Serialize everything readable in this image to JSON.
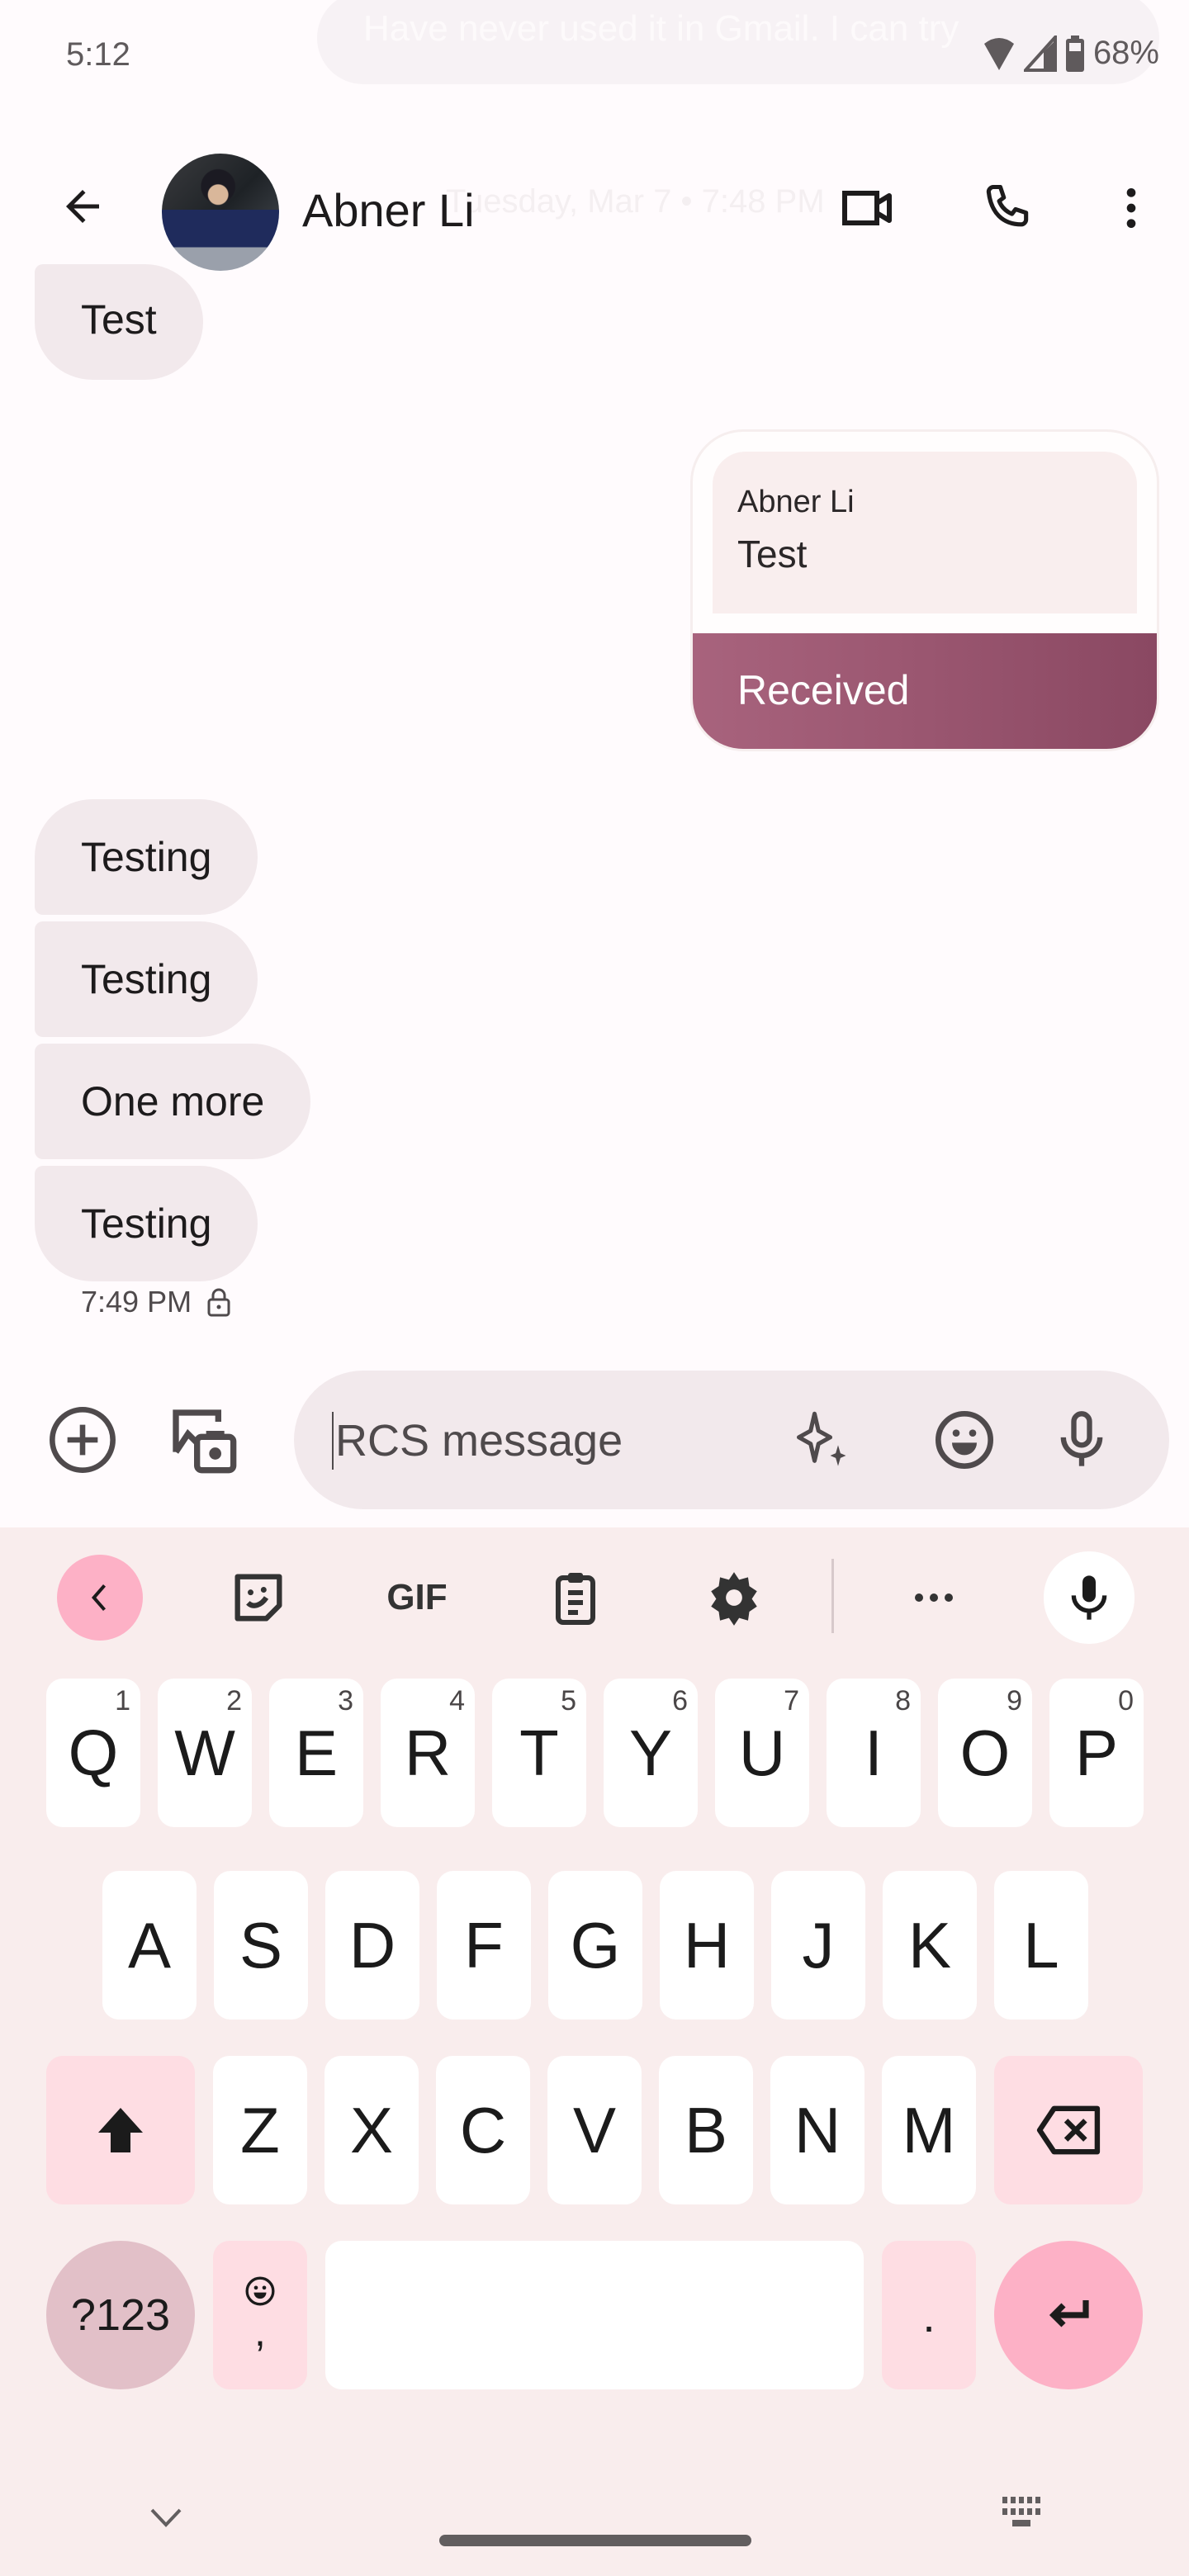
{
  "status_bar": {
    "time": "5:12",
    "battery_percent": "68%",
    "icons": [
      "wifi-icon",
      "cell-signal-icon",
      "battery-icon"
    ],
    "notification_peek": "Have never used it in Gmail. I can try"
  },
  "header": {
    "back_icon": "arrow-back-icon",
    "contact_name": "Abner Li",
    "sticky_date": "Tuesday, Mar 7 • 7:48 PM",
    "actions": [
      "video-call-icon",
      "phone-icon",
      "more-vert-icon"
    ]
  },
  "messages": {
    "top_partial": "Test",
    "card": {
      "quoted_sender": "Abner Li",
      "quoted_text": "Test",
      "reply": "Received"
    },
    "incoming": [
      {
        "text": "Testing"
      },
      {
        "text": "Testing"
      },
      {
        "text": "One more"
      },
      {
        "text": "Testing"
      }
    ],
    "timestamp": "7:49 PM",
    "lock_icon": "lock-icon"
  },
  "compose": {
    "placeholder": "RCS message",
    "value": "",
    "left_icons": [
      "add-circle-icon",
      "gallery-camera-icon"
    ],
    "right_icons": [
      "sparkle-icon",
      "emoji-icon",
      "mic-icon"
    ]
  },
  "keyboard": {
    "toolbar": [
      "collapse-icon",
      "sticker-icon",
      "gif-icon",
      "clipboard-icon",
      "settings-icon",
      "more-horiz-icon",
      "voice-input-icon"
    ],
    "gif_label": "GIF",
    "row1": [
      {
        "key": "Q",
        "hint": "1"
      },
      {
        "key": "W",
        "hint": "2"
      },
      {
        "key": "E",
        "hint": "3"
      },
      {
        "key": "R",
        "hint": "4"
      },
      {
        "key": "T",
        "hint": "5"
      },
      {
        "key": "Y",
        "hint": "6"
      },
      {
        "key": "U",
        "hint": "7"
      },
      {
        "key": "I",
        "hint": "8"
      },
      {
        "key": "O",
        "hint": "9"
      },
      {
        "key": "P",
        "hint": "0"
      }
    ],
    "row2": [
      "A",
      "S",
      "D",
      "F",
      "G",
      "H",
      "J",
      "K",
      "L"
    ],
    "row3": [
      "Z",
      "X",
      "C",
      "V",
      "B",
      "N",
      "M"
    ],
    "symbols_label": "?123",
    "comma_label": ",",
    "period_label": ".",
    "accent_color": "#fdb1c6",
    "modifier_color": "#fedde3"
  },
  "nav": {
    "left_icon": "chevron-down-icon",
    "right_icon": "keyboard-switch-icon"
  }
}
